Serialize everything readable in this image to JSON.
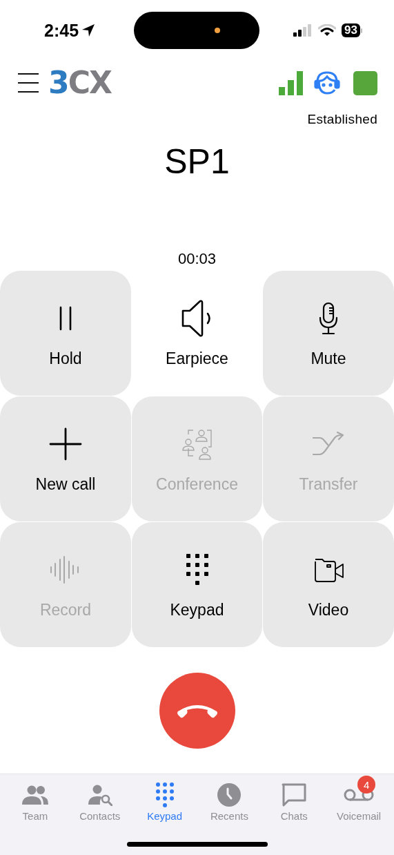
{
  "status_bar": {
    "time": "2:45",
    "battery": "93"
  },
  "header": {
    "logo": {
      "lead": "3",
      "rest": "CX"
    },
    "status": "Established"
  },
  "call": {
    "name": "SP1",
    "duration": "00:03"
  },
  "actions": [
    {
      "kind": "hold",
      "label": "Hold",
      "disabled": false,
      "framed": true
    },
    {
      "kind": "earpiece",
      "label": "Earpiece",
      "disabled": false,
      "framed": false
    },
    {
      "kind": "mute",
      "label": "Mute",
      "disabled": false,
      "framed": true
    },
    {
      "kind": "new_call",
      "label": "New call",
      "disabled": false,
      "framed": true
    },
    {
      "kind": "conference",
      "label": "Conference",
      "disabled": true,
      "framed": true
    },
    {
      "kind": "transfer",
      "label": "Transfer",
      "disabled": true,
      "framed": true
    },
    {
      "kind": "record",
      "label": "Record",
      "disabled": true,
      "framed": true
    },
    {
      "kind": "keypad",
      "label": "Keypad",
      "disabled": false,
      "framed": true
    },
    {
      "kind": "video",
      "label": "Video",
      "disabled": false,
      "framed": true
    }
  ],
  "tabs": [
    {
      "kind": "team",
      "label": "Team",
      "selected": false
    },
    {
      "kind": "contacts",
      "label": "Contacts",
      "selected": false
    },
    {
      "kind": "keypad",
      "label": "Keypad",
      "selected": true
    },
    {
      "kind": "recents",
      "label": "Recents",
      "selected": false
    },
    {
      "kind": "chats",
      "label": "Chats",
      "selected": false
    },
    {
      "kind": "voicemail",
      "label": "Voicemail",
      "selected": false,
      "badge": "4"
    }
  ]
}
